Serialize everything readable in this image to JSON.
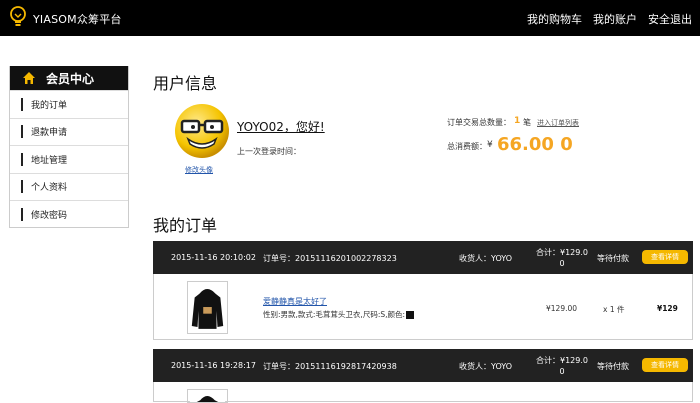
{
  "header": {
    "brand": "YIASOM众筹平台",
    "logo_icon": "lightbulb-icon",
    "nav": [
      "我的购物车",
      "我的账户",
      "安全退出"
    ]
  },
  "sidebar": {
    "title": "会员中心",
    "title_icon": "home-icon",
    "items": [
      "我的订单",
      "退款申请",
      "地址管理",
      "个人资料",
      "修改密码"
    ]
  },
  "user_info": {
    "title": "用户信息",
    "change_avatar": "修改头像",
    "greeting": "YOYO02，您好!",
    "last_login_label": "上一次登录时间：",
    "order_count_label": "订单交易总数量：",
    "order_count": "1",
    "order_count_unit": "笔",
    "order_list_link": "进入订单列表",
    "total_spent_label": "总消费额：",
    "currency": "¥",
    "total_spent": "66.00 0"
  },
  "orders": {
    "title": "我的订单",
    "list": [
      {
        "date": "2015-11-16 20:10:02",
        "order_no": "订单号：20151116201002278323",
        "receiver": "收货人：YOYO",
        "total_label": "合计：¥129.0",
        "total_value": "0",
        "status": "等待付款",
        "details_btn": "查看详情",
        "product_name": "爱静静真是太好了",
        "product_attr": "性别:男款,款式:毛茸茸头卫衣,尺码:S,颜色:",
        "price": "¥129.00",
        "qty": "x 1 件",
        "subtotal": "¥129"
      },
      {
        "date": "2015-11-16 19:28:17",
        "order_no": "订单号：20151116192817420938",
        "receiver": "收货人：YOYO",
        "total_label": "合计：¥129.0",
        "total_value": "0",
        "status": "等待付款",
        "details_btn": "查看详情",
        "product_name": "",
        "product_attr": "",
        "price": "",
        "qty": "",
        "subtotal": ""
      }
    ]
  },
  "colors": {
    "accent": "#f5a623",
    "button": "#f5b800",
    "bar": "#000000"
  }
}
